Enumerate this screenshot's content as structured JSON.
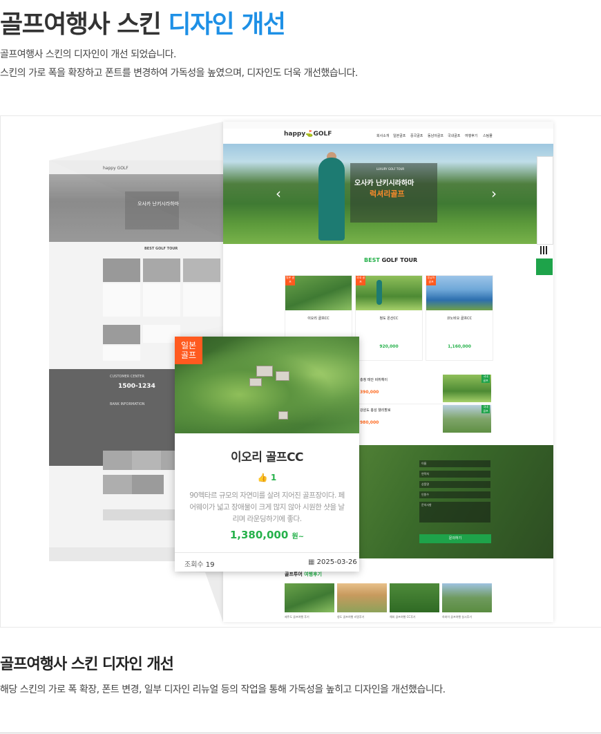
{
  "header": {
    "title_main": "골프여행사 스킨 ",
    "title_accent": "디자인 개선",
    "desc_line1": "골프여행사 스킨의 디자인이 개선 되었습니다.",
    "desc_line2": "스킨의 가로 폭을 확장하고 폰트를 변경하여 가독성을 높였으며, 디자인도 더욱 개선했습니다."
  },
  "new_site": {
    "logo": "happy GOLF",
    "menu": [
      "회사소개",
      "일본골프",
      "중국골프",
      "동남아골프",
      "국내골프",
      "여행후기",
      "스팀몰"
    ],
    "hero": {
      "eyebrow": "LUXURY GOLF TOUR",
      "title": "오사카 난키시라하마",
      "subtitle": "럭셔리골프"
    },
    "best_title_green": "BEST",
    "best_title_rest": " GOLF TOUR",
    "cards": [
      {
        "tag": "일본 골프",
        "name": "이오리 골프CC",
        "price": "1,380,000"
      },
      {
        "tag": "국내 골프",
        "name": "청도 온산CC",
        "price": "920,000"
      },
      {
        "tag": "동남아 골프",
        "name": "코노비오 골프CC",
        "price": "1,160,000"
      }
    ],
    "list_items": [
      {
        "name": "충청 태안 비취헤이",
        "price": "390,000",
        "tag": "국내 골프"
      },
      {
        "name": "강원도 홍성 웰리할로",
        "price": "980,000",
        "tag": "국내 골프"
      }
    ],
    "form": {
      "fields": [
        "이름",
        "연락처",
        "상품명",
        "인원수",
        "문의사항"
      ],
      "submit": "문의하기"
    },
    "reviews_title_main": "골프투어",
    "reviews_title_accent": " 여행후기",
    "reviews": [
      "제주도 골프여행 후기",
      "청도 골프여행 리얼후기",
      "해외 골프여행 CC후기",
      "하와이 골프여행 실시후기"
    ]
  },
  "zoom_card": {
    "tag": "일본\n골프",
    "name": "이오리 골프CC",
    "likes": "1",
    "desc": "90헥타르 규모의 자연미를 살려 지어진 골프장이다. 페어웨이가 넓고 장애물이 크게 많지 않아 시원한 샷을 날리며 라운딩하기에 좋다.",
    "price": "1,380,000",
    "price_unit": "원~",
    "views_label": "조회수",
    "views": "19",
    "date": "2025-03-26"
  },
  "old_site": {
    "hero_title": "오사카 난키시라하마",
    "best_title": "BEST GOLF TOUR",
    "customer_center": "CUSTOMER CENTER",
    "phone": "1500-1234",
    "bank": "BANK INFORMATION"
  },
  "section2": {
    "title": "골프여행사 스킨 디자인 개선",
    "desc": "해당 스킨의 가로 폭 확장, 폰트 변경, 일부 디자인 리뉴얼 등의 작업을 통해 가독성을 높히고 디자인을 개선했습니다."
  },
  "colors": {
    "accent_blue": "#1e90e6",
    "brand_green": "#26b14b",
    "tag_orange": "#ff5a1f"
  }
}
